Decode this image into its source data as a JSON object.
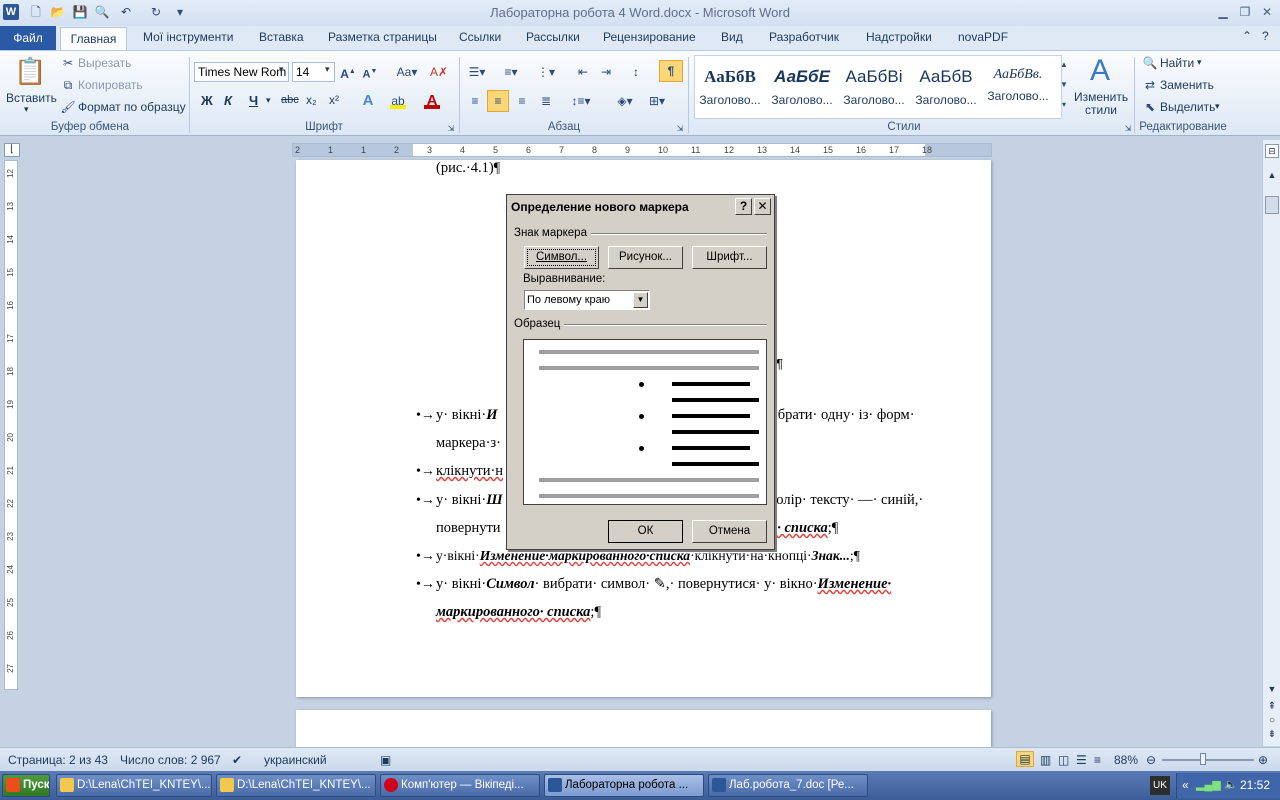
{
  "window": {
    "title": "Лабораторна робота 4 Word.docx - Microsoft Word"
  },
  "tabs": {
    "file": "Файл",
    "home": "Главная",
    "items": [
      "Мої інструменти",
      "Вставка",
      "Разметка страницы",
      "Ссылки",
      "Рассылки",
      "Рецензирование",
      "Вид",
      "Разработчик",
      "Надстройки",
      "novaPDF"
    ]
  },
  "ribbon": {
    "clipboard": {
      "paste": "Вставить",
      "cut": "Вырезать",
      "copy": "Копировать",
      "format_painter": "Формат по образцу",
      "label": "Буфер обмена"
    },
    "font": {
      "name": "Times New Rom",
      "size": "14",
      "label": "Шрифт",
      "bold": "Ж",
      "italic": "К",
      "underline": "Ч",
      "strike": "abc",
      "sub": "x₂",
      "sup": "x²"
    },
    "paragraph": {
      "label": "Абзац"
    },
    "styles": {
      "label": "Стили",
      "change": "Изменить стили",
      "samples": [
        {
          "sample": "АаБбВ",
          "name": "Заголово..."
        },
        {
          "sample": "АаБбЕ",
          "name": "Заголово..."
        },
        {
          "sample": "АаБбВі",
          "name": "Заголово..."
        },
        {
          "sample": "АаБбВ",
          "name": "Заголово..."
        },
        {
          "sample": "АаБбВв.",
          "name": "Заголово..."
        }
      ]
    },
    "editing": {
      "label": "Редактирование",
      "find": "Найти",
      "replace": "Заменить",
      "select": "Выделить"
    }
  },
  "document": {
    "line0": "(рис.·4.1)¶",
    "b1_a": "у· вікні·",
    "b1_b": "И",
    "b1_c": "ибрати· одну· із· форм·",
    "b1_line2": "маркера·з·",
    "b2": "клікнути·н",
    "b3_a": "у· вікні·",
    "b3_b": "Ш",
    "b3_c": "колір· тексту· —· синій,·",
    "b3_line2_a": "повернути",
    "b3_line2_b": "о· списка",
    "b3_line2_c": ";¶",
    "b4_a": "у·вікні·",
    "b4_b": "Изменение·маркированного·списка",
    "b4_c": "·клікнути·на·кнопці·",
    "b4_d": "Знак...",
    "b4_e": ";¶",
    "b5_a": "у· вікні·",
    "b5_b": "Символ",
    "b5_c": "· вибрати· символ· ",
    "b5_sym": "✎",
    "b5_d": ",· повернутися· у· вікно·",
    "b5_e": "Изменение·",
    "b5_line2": "маркированного· списка",
    "b5_line2_end": ";¶",
    "bullet": "•→",
    "mark": "¶"
  },
  "dialog": {
    "title": "Определение нового маркера",
    "help": "?",
    "close": "✕",
    "group_marker": "Знак маркера",
    "btn_symbol": "Символ...",
    "btn_picture": "Рисунок...",
    "btn_font": "Шрифт...",
    "align_label": "Выравнивание:",
    "align_value": "По левому краю",
    "group_preview": "Образец",
    "ok": "ОК",
    "cancel": "Отмена"
  },
  "status": {
    "page": "Страница: 2 из 43",
    "words": "Число слов: 2 967",
    "language": "украинский",
    "zoom": "88%"
  },
  "taskbar": {
    "start": "Пуск",
    "items": [
      "D:\\Lena\\ChTEI_KNTEY\\...",
      "D:\\Lena\\ChTEI_KNTEY\\...",
      "Комп'ютер — Вікіпеді...",
      "Лабораторна робота ...",
      "Лаб.робота_7.doc [Ре..."
    ],
    "lang": "UK",
    "time": "21:52"
  },
  "ruler": {
    "h_ticks": [
      "2",
      "1",
      "1",
      "2",
      "3",
      "4",
      "5",
      "6",
      "7",
      "8",
      "9",
      "10",
      "11",
      "12",
      "13",
      "14",
      "15",
      "16",
      "17",
      "18"
    ],
    "v_ticks": [
      "12",
      "13",
      "14",
      "15",
      "16",
      "17",
      "18",
      "19",
      "20",
      "21",
      "22",
      "23",
      "24",
      "25",
      "26",
      "27"
    ]
  }
}
